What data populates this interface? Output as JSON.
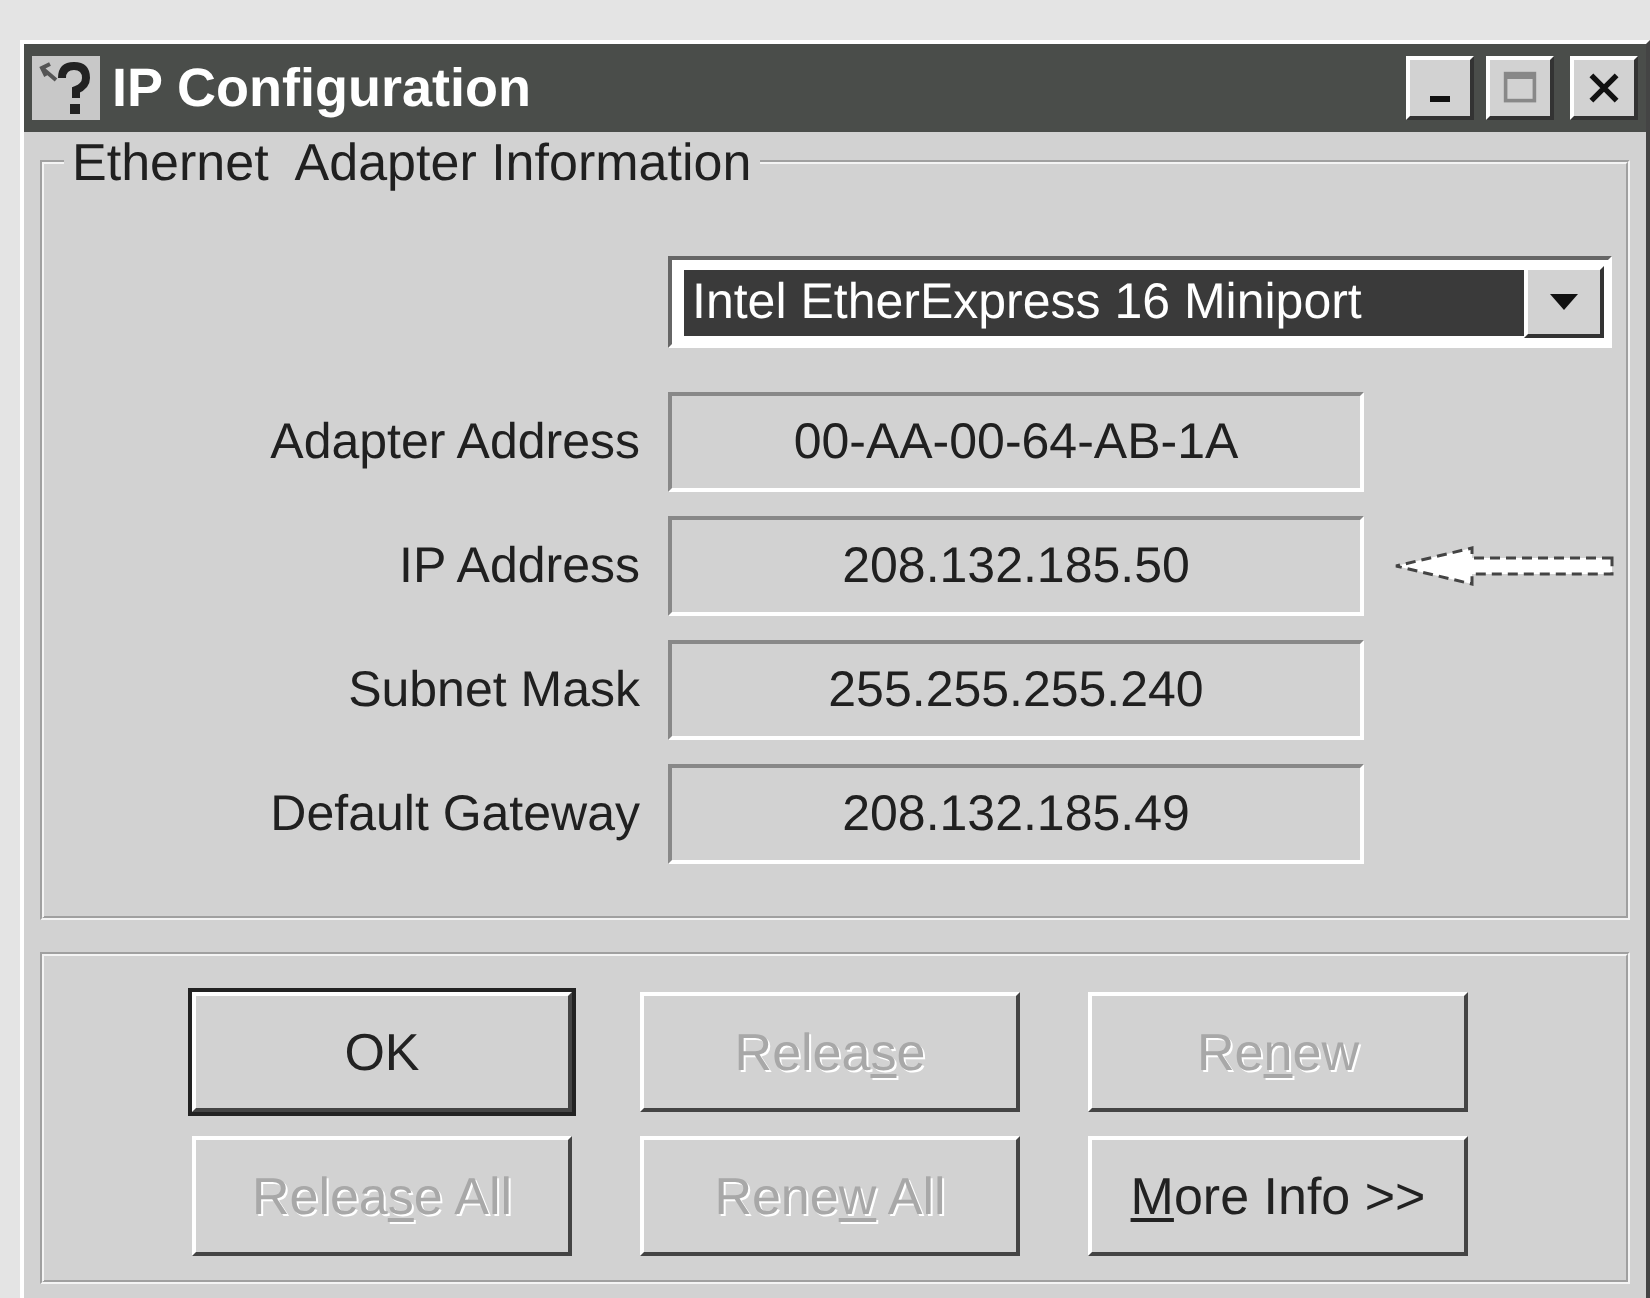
{
  "window": {
    "title": "IP Configuration"
  },
  "adapter_group": {
    "title": "Ethernet  Adapter Information",
    "adapter_select": {
      "value": "Intel EtherExpress 16 Miniport"
    },
    "fields": [
      {
        "label": "Adapter Address",
        "value": "00-AA-00-64-AB-1A",
        "pointed": false
      },
      {
        "label": "IP Address",
        "value": "208.132.185.50",
        "pointed": true
      },
      {
        "label": "Subnet Mask",
        "value": "255.255.255.240",
        "pointed": false
      },
      {
        "label": "Default Gateway",
        "value": "208.132.185.49",
        "pointed": false
      }
    ]
  },
  "buttons": [
    {
      "label": "OK",
      "default": true,
      "disabled": false
    },
    {
      "label_before": "Relea",
      "access_key": "s",
      "label_after": "e",
      "default": false,
      "disabled": true
    },
    {
      "label_before": "Re",
      "access_key": "n",
      "label_after": "ew",
      "default": false,
      "disabled": true
    },
    {
      "label_before": "Relea",
      "access_key": "s",
      "label_after": "e All",
      "default": false,
      "disabled": true
    },
    {
      "label_before": "Rene",
      "access_key": "w",
      "label_after": " All",
      "default": false,
      "disabled": true
    },
    {
      "access_key": "M",
      "label_after": "ore Info >>",
      "default": false,
      "disabled": false
    }
  ]
}
